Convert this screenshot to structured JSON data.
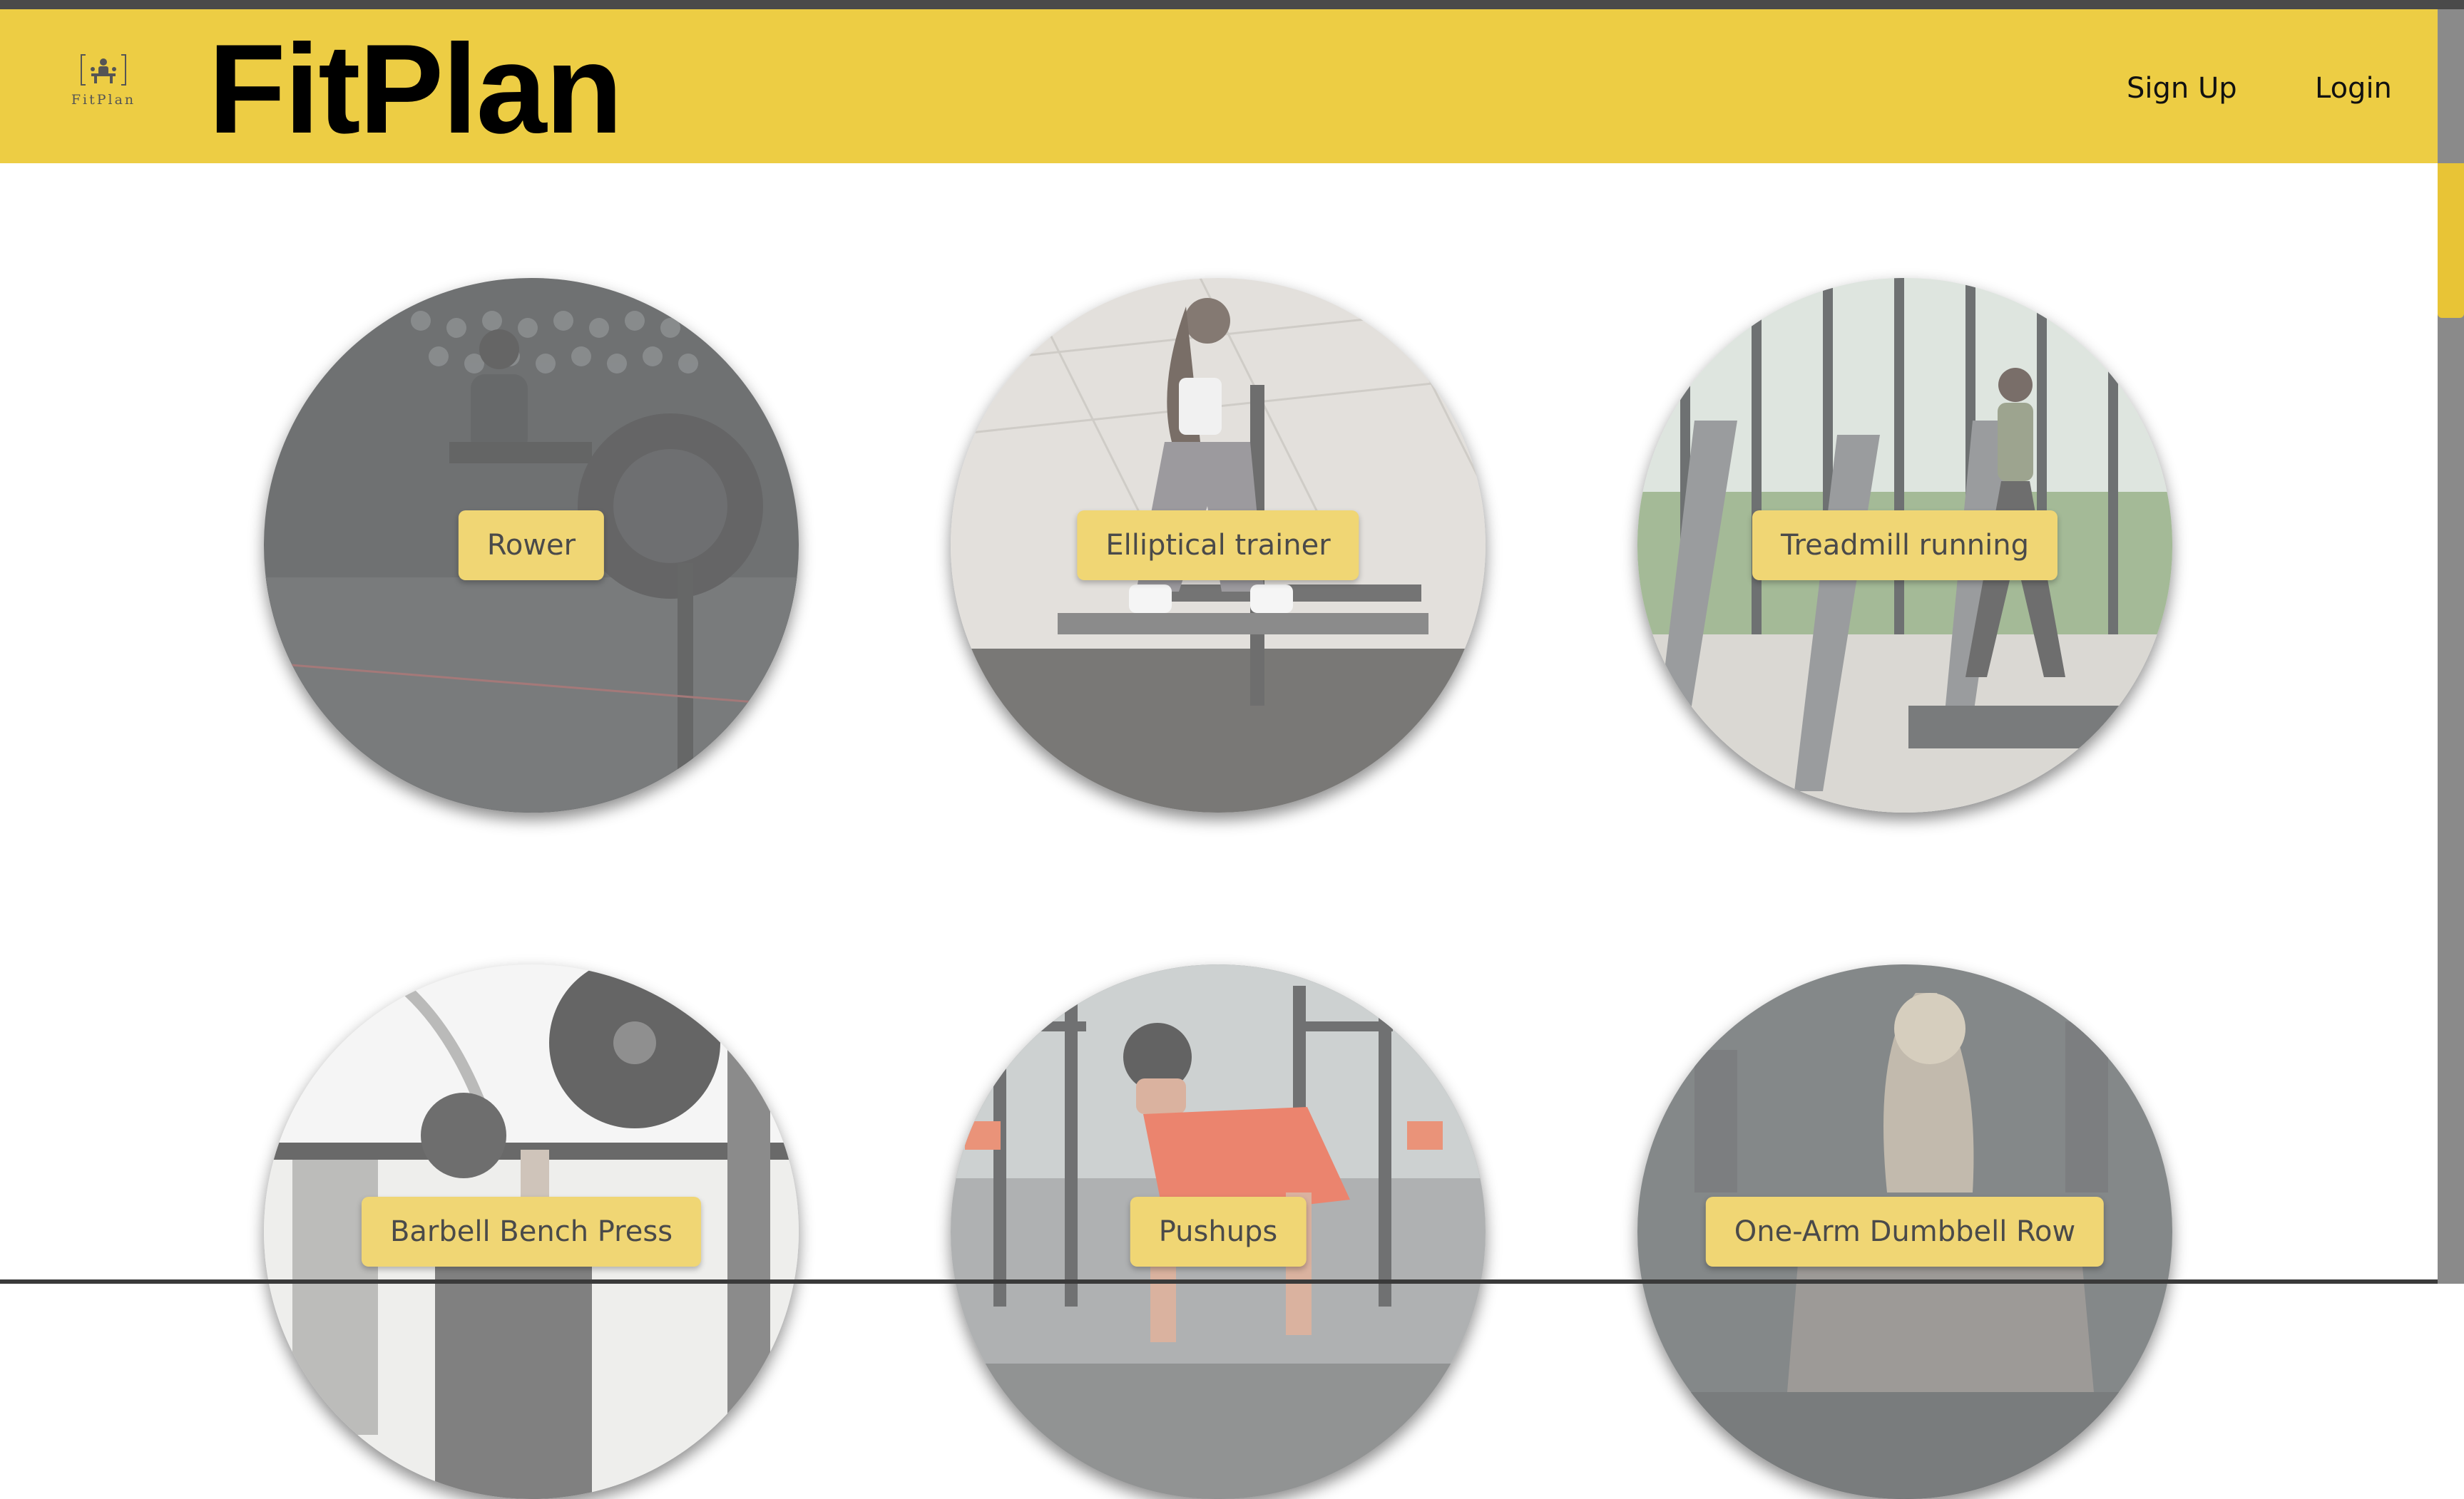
{
  "header": {
    "logo_text": "FitPlan",
    "brand_title": "FitPlan",
    "nav": {
      "signup": "Sign Up",
      "login": "Login"
    }
  },
  "colors": {
    "accent": "#edcd44",
    "label_bg": "#f0d674",
    "scroll_thumb": "#e8c436"
  },
  "exercises": [
    {
      "label": "Rower"
    },
    {
      "label": "Elliptical trainer"
    },
    {
      "label": "Treadmill running"
    },
    {
      "label": "Barbell Bench Press"
    },
    {
      "label": "Pushups"
    },
    {
      "label": "One-Arm Dumbbell Row"
    }
  ]
}
